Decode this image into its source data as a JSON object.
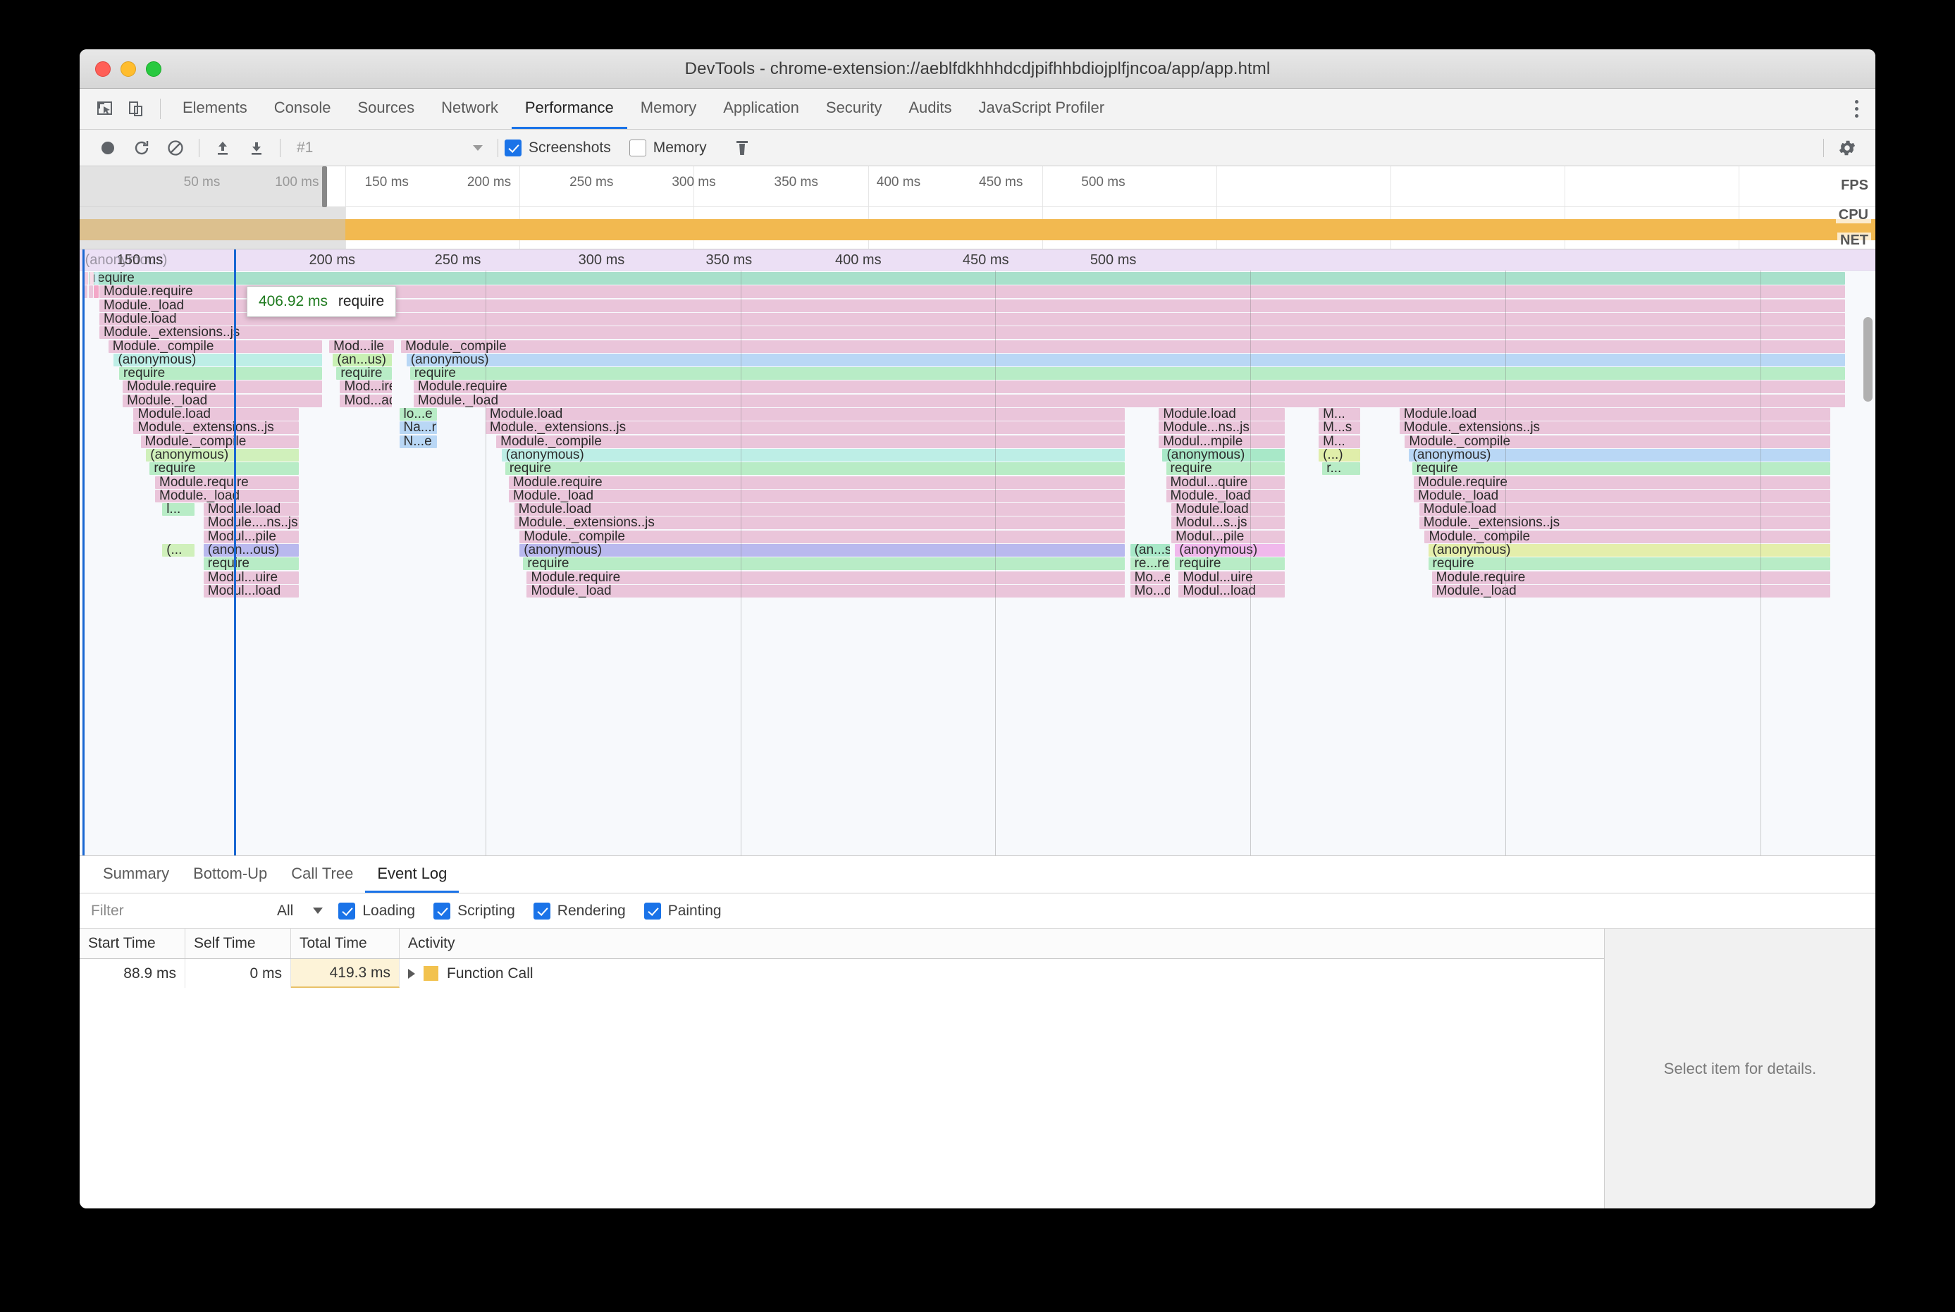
{
  "window": {
    "title": "DevTools - chrome-extension://aeblfdkhhhdcdjpifhhbdiojplfjncoa/app/app.html",
    "traffic": [
      "close-button",
      "minimize-button",
      "zoom-button"
    ]
  },
  "panel_tabs": [
    {
      "label": "Elements",
      "active": false
    },
    {
      "label": "Console",
      "active": false
    },
    {
      "label": "Sources",
      "active": false
    },
    {
      "label": "Network",
      "active": false
    },
    {
      "label": "Performance",
      "active": true
    },
    {
      "label": "Memory",
      "active": false
    },
    {
      "label": "Application",
      "active": false
    },
    {
      "label": "Security",
      "active": false
    },
    {
      "label": "Audits",
      "active": false
    },
    {
      "label": "JavaScript Profiler",
      "active": false
    }
  ],
  "toolbar": {
    "record_icon": "record-icon",
    "reload_icon": "reload-record-icon",
    "clear_icon": "clear-icon",
    "load_icon": "load-profile-icon",
    "save_icon": "save-profile-icon",
    "profile_value": "#1",
    "screenshots_label": "Screenshots",
    "screenshots_checked": true,
    "memory_label": "Memory",
    "memory_checked": false,
    "trash_icon": "trash-icon",
    "gear_icon": "gear-icon",
    "kebab_icon": "more-options-icon"
  },
  "overview": {
    "ticks": [
      "50 ms",
      "100 ms",
      "150 ms",
      "200 ms",
      "250 ms",
      "300 ms",
      "350 ms",
      "400 ms",
      "450 ms",
      "500 ms"
    ],
    "lane_labels": [
      "FPS",
      "CPU",
      "NET"
    ],
    "cpu_color": "#f2b950",
    "dimmed_end_pct": 22.5
  },
  "flame": {
    "ticks": [
      "150 ms",
      "200 ms",
      "250 ms",
      "300 ms",
      "350 ms",
      "400 ms",
      "450 ms",
      "500 ms"
    ],
    "ghost_label": "(anonymous)",
    "tooltip": {
      "time": "406.92 ms",
      "name": "require"
    },
    "rows": [
      [
        {
          "t": "require",
          "x": 0.5,
          "w": 97.8,
          "c": "#a8e0cb"
        }
      ],
      [
        {
          "t": "Module.require",
          "x": 1.1,
          "w": 97.2,
          "c": "#eac5da"
        }
      ],
      [
        {
          "t": "Module._load",
          "x": 1.1,
          "w": 97.2,
          "c": "#eac5da"
        }
      ],
      [
        {
          "t": "Module.load",
          "x": 1.1,
          "w": 97.2,
          "c": "#eac5da"
        }
      ],
      [
        {
          "t": "Module._extensions..js",
          "x": 1.1,
          "w": 97.2,
          "c": "#eac5da"
        }
      ],
      [
        {
          "t": "Module._compile",
          "x": 1.6,
          "w": 11.9,
          "c": "#eac5da"
        },
        {
          "t": "Mod...ile",
          "x": 13.9,
          "w": 3.6,
          "c": "#eac5da"
        },
        {
          "t": "Module._compile",
          "x": 17.9,
          "w": 80.4,
          "c": "#eac5da"
        }
      ],
      [
        {
          "t": "(anonymous)",
          "x": 1.9,
          "w": 11.6,
          "c": "#bdeee6"
        },
        {
          "t": "(an...us)",
          "x": 14.1,
          "w": 3.3,
          "c": "#c9f0b4"
        },
        {
          "t": "(anonymous)",
          "x": 18.2,
          "w": 80.1,
          "c": "#b9d7f5"
        }
      ],
      [
        {
          "t": "require",
          "x": 2.2,
          "w": 11.3,
          "c": "#b8ecc6"
        },
        {
          "t": "require",
          "x": 14.3,
          "w": 3.1,
          "c": "#b8ecc6"
        },
        {
          "t": "require",
          "x": 18.4,
          "w": 79.9,
          "c": "#b8ecc6"
        }
      ],
      [
        {
          "t": "Module.require",
          "x": 2.4,
          "w": 11.1,
          "c": "#eac5da"
        },
        {
          "t": "Mod...ire",
          "x": 14.5,
          "w": 2.9,
          "c": "#eac5da"
        },
        {
          "t": "Module.require",
          "x": 18.6,
          "w": 79.7,
          "c": "#eac5da"
        }
      ],
      [
        {
          "t": "Module._load",
          "x": 2.4,
          "w": 11.1,
          "c": "#eac5da"
        },
        {
          "t": "Mod...ad",
          "x": 14.5,
          "w": 2.9,
          "c": "#eac5da"
        },
        {
          "t": "Module._load",
          "x": 18.6,
          "w": 79.7,
          "c": "#eac5da"
        }
      ],
      [
        {
          "t": "Module.load",
          "x": 3.0,
          "w": 9.2,
          "c": "#eac5da"
        },
        {
          "t": "lo...e",
          "x": 17.8,
          "w": 2.1,
          "c": "#b8ecc6"
        },
        {
          "t": "Module.load",
          "x": 22.6,
          "w": 35.6,
          "c": "#eac5da"
        },
        {
          "t": "Module.load",
          "x": 60.1,
          "w": 7.0,
          "c": "#eac5da"
        },
        {
          "t": "M...",
          "x": 69.0,
          "w": 2.3,
          "c": "#eac5da"
        },
        {
          "t": "Module.load",
          "x": 73.5,
          "w": 24.0,
          "c": "#eac5da"
        }
      ],
      [
        {
          "t": "Module._extensions..js",
          "x": 3.0,
          "w": 9.2,
          "c": "#eac5da"
        },
        {
          "t": "Na...r",
          "x": 17.8,
          "w": 2.1,
          "c": "#b9d7f5"
        },
        {
          "t": "Module._extensions..js",
          "x": 22.6,
          "w": 35.6,
          "c": "#eac5da"
        },
        {
          "t": "Module...ns..js",
          "x": 60.1,
          "w": 7.0,
          "c": "#eac5da"
        },
        {
          "t": "M...s",
          "x": 69.0,
          "w": 2.3,
          "c": "#eac5da"
        },
        {
          "t": "Module._extensions..js",
          "x": 73.5,
          "w": 24.0,
          "c": "#eac5da"
        }
      ],
      [
        {
          "t": "Module._compile",
          "x": 3.4,
          "w": 8.8,
          "c": "#eac5da"
        },
        {
          "t": "N...e",
          "x": 17.8,
          "w": 2.1,
          "c": "#b9d7f5"
        },
        {
          "t": "Module._compile",
          "x": 23.2,
          "w": 35.0,
          "c": "#eac5da"
        },
        {
          "t": "Modul...mpile",
          "x": 60.1,
          "w": 7.0,
          "c": "#eac5da"
        },
        {
          "t": "M...",
          "x": 69.0,
          "w": 2.3,
          "c": "#eac5da"
        },
        {
          "t": "Module._compile",
          "x": 73.8,
          "w": 23.7,
          "c": "#eac5da"
        }
      ],
      [
        {
          "t": "(anonymous)",
          "x": 3.7,
          "w": 8.5,
          "c": "#d0f0bb"
        },
        {
          "t": "(anonymous)",
          "x": 23.5,
          "w": 34.7,
          "c": "#bdeee6"
        },
        {
          "t": "(anonymous)",
          "x": 60.3,
          "w": 6.8,
          "c": "#a8e8c8"
        },
        {
          "t": "(...)",
          "x": 69.0,
          "w": 2.3,
          "c": "#e0eeaa"
        },
        {
          "t": "(anonymous)",
          "x": 74.0,
          "w": 23.5,
          "c": "#b9d7f5"
        }
      ],
      [
        {
          "t": "require",
          "x": 3.9,
          "w": 8.3,
          "c": "#b8ecc6"
        },
        {
          "t": "require",
          "x": 23.7,
          "w": 34.5,
          "c": "#b8ecc6"
        },
        {
          "t": "require",
          "x": 60.5,
          "w": 6.6,
          "c": "#b8ecc6"
        },
        {
          "t": "r...",
          "x": 69.2,
          "w": 2.1,
          "c": "#b8ecc6"
        },
        {
          "t": "require",
          "x": 74.2,
          "w": 23.3,
          "c": "#b8ecc6"
        }
      ],
      [
        {
          "t": "Module.require",
          "x": 4.2,
          "w": 8.0,
          "c": "#eac5da"
        },
        {
          "t": "Module.require",
          "x": 23.9,
          "w": 34.3,
          "c": "#eac5da"
        },
        {
          "t": "Modul...quire",
          "x": 60.5,
          "w": 6.6,
          "c": "#eac5da"
        },
        {
          "t": "Module.require",
          "x": 74.3,
          "w": 23.2,
          "c": "#eac5da"
        }
      ],
      [
        {
          "t": "Module._load",
          "x": 4.2,
          "w": 8.0,
          "c": "#eac5da"
        },
        {
          "t": "Module._load",
          "x": 23.9,
          "w": 34.3,
          "c": "#eac5da"
        },
        {
          "t": "Module._load",
          "x": 60.5,
          "w": 6.6,
          "c": "#eac5da"
        },
        {
          "t": "Module._load",
          "x": 74.3,
          "w": 23.2,
          "c": "#eac5da"
        }
      ],
      [
        {
          "t": "l...",
          "x": 4.6,
          "w": 1.8,
          "c": "#b8ecc6"
        },
        {
          "t": "Module.load",
          "x": 6.9,
          "w": 5.3,
          "c": "#eac5da"
        },
        {
          "t": "Module.load",
          "x": 24.2,
          "w": 34.0,
          "c": "#eac5da"
        },
        {
          "t": "Module.load",
          "x": 60.8,
          "w": 6.3,
          "c": "#eac5da"
        },
        {
          "t": "Module.load",
          "x": 74.6,
          "w": 22.9,
          "c": "#eac5da"
        }
      ],
      [
        {
          "t": "Module....ns..js",
          "x": 6.9,
          "w": 5.3,
          "c": "#eac5da"
        },
        {
          "t": "Module._extensions..js",
          "x": 24.2,
          "w": 34.0,
          "c": "#eac5da"
        },
        {
          "t": "Modul...s..js",
          "x": 60.8,
          "w": 6.3,
          "c": "#eac5da"
        },
        {
          "t": "Module._extensions..js",
          "x": 74.6,
          "w": 22.9,
          "c": "#eac5da"
        }
      ],
      [
        {
          "t": "Modul...pile",
          "x": 6.9,
          "w": 5.3,
          "c": "#eac5da"
        },
        {
          "t": "Module._compile",
          "x": 24.5,
          "w": 33.7,
          "c": "#eac5da"
        },
        {
          "t": "Modul...pile",
          "x": 60.8,
          "w": 6.3,
          "c": "#eac5da"
        },
        {
          "t": "Module._compile",
          "x": 74.9,
          "w": 22.6,
          "c": "#eac5da"
        }
      ],
      [
        {
          "t": "(...",
          "x": 4.6,
          "w": 1.8,
          "c": "#d0f0bb"
        },
        {
          "t": "(anon...ous)",
          "x": 6.9,
          "w": 5.3,
          "c": "#b9b9ee"
        },
        {
          "t": "(anonymous)",
          "x": 24.5,
          "w": 33.7,
          "c": "#b9b9ee"
        },
        {
          "t": "(an...s)",
          "x": 58.5,
          "w": 2.2,
          "c": "#a8e8c8"
        },
        {
          "t": "(anonymous)",
          "x": 61.0,
          "w": 6.1,
          "c": "#f0b8ec"
        },
        {
          "t": "(anonymous)",
          "x": 75.1,
          "w": 22.4,
          "c": "#e4eeab"
        }
      ],
      [
        {
          "t": "require",
          "x": 6.9,
          "w": 5.3,
          "c": "#b8ecc6"
        },
        {
          "t": "require",
          "x": 24.7,
          "w": 33.5,
          "c": "#b8ecc6"
        },
        {
          "t": "re...re",
          "x": 58.5,
          "w": 2.2,
          "c": "#b8ecc6"
        },
        {
          "t": "require",
          "x": 61.0,
          "w": 6.1,
          "c": "#b8ecc6"
        },
        {
          "t": "require",
          "x": 75.1,
          "w": 22.4,
          "c": "#b8ecc6"
        }
      ],
      [
        {
          "t": "Modul...uire",
          "x": 6.9,
          "w": 5.3,
          "c": "#eac5da"
        },
        {
          "t": "Module.require",
          "x": 24.9,
          "w": 33.3,
          "c": "#eac5da"
        },
        {
          "t": "Mo...e",
          "x": 58.5,
          "w": 2.2,
          "c": "#eac5da"
        },
        {
          "t": "Modul...uire",
          "x": 61.2,
          "w": 5.9,
          "c": "#eac5da"
        },
        {
          "t": "Module.require",
          "x": 75.3,
          "w": 22.2,
          "c": "#eac5da"
        }
      ],
      [
        {
          "t": "Modul...load",
          "x": 6.9,
          "w": 5.3,
          "c": "#eac5da"
        },
        {
          "t": "Module._load",
          "x": 24.9,
          "w": 33.3,
          "c": "#eac5da"
        },
        {
          "t": "Mo...d",
          "x": 58.5,
          "w": 2.2,
          "c": "#eac5da"
        },
        {
          "t": "Modul...load",
          "x": 61.2,
          "w": 5.9,
          "c": "#eac5da"
        },
        {
          "t": "Module._load",
          "x": 75.3,
          "w": 22.2,
          "c": "#eac5da"
        }
      ]
    ]
  },
  "drawer": {
    "tabs": [
      {
        "label": "Summary",
        "active": false
      },
      {
        "label": "Bottom-Up",
        "active": false
      },
      {
        "label": "Call Tree",
        "active": false
      },
      {
        "label": "Event Log",
        "active": true
      }
    ],
    "filter_placeholder": "Filter",
    "filter_value": "",
    "category_select": "All",
    "checkboxes": [
      {
        "label": "Loading",
        "checked": true
      },
      {
        "label": "Scripting",
        "checked": true
      },
      {
        "label": "Rendering",
        "checked": true
      },
      {
        "label": "Painting",
        "checked": true
      }
    ],
    "columns": [
      "Start Time",
      "Self Time",
      "Total Time",
      "Activity"
    ],
    "rows": [
      {
        "start_time": "88.9 ms",
        "self_time": "0 ms",
        "total_time": "419.3 ms",
        "activity": "Function Call",
        "swatch_color": "#f2c24e"
      }
    ],
    "details_message": "Select item for details."
  }
}
